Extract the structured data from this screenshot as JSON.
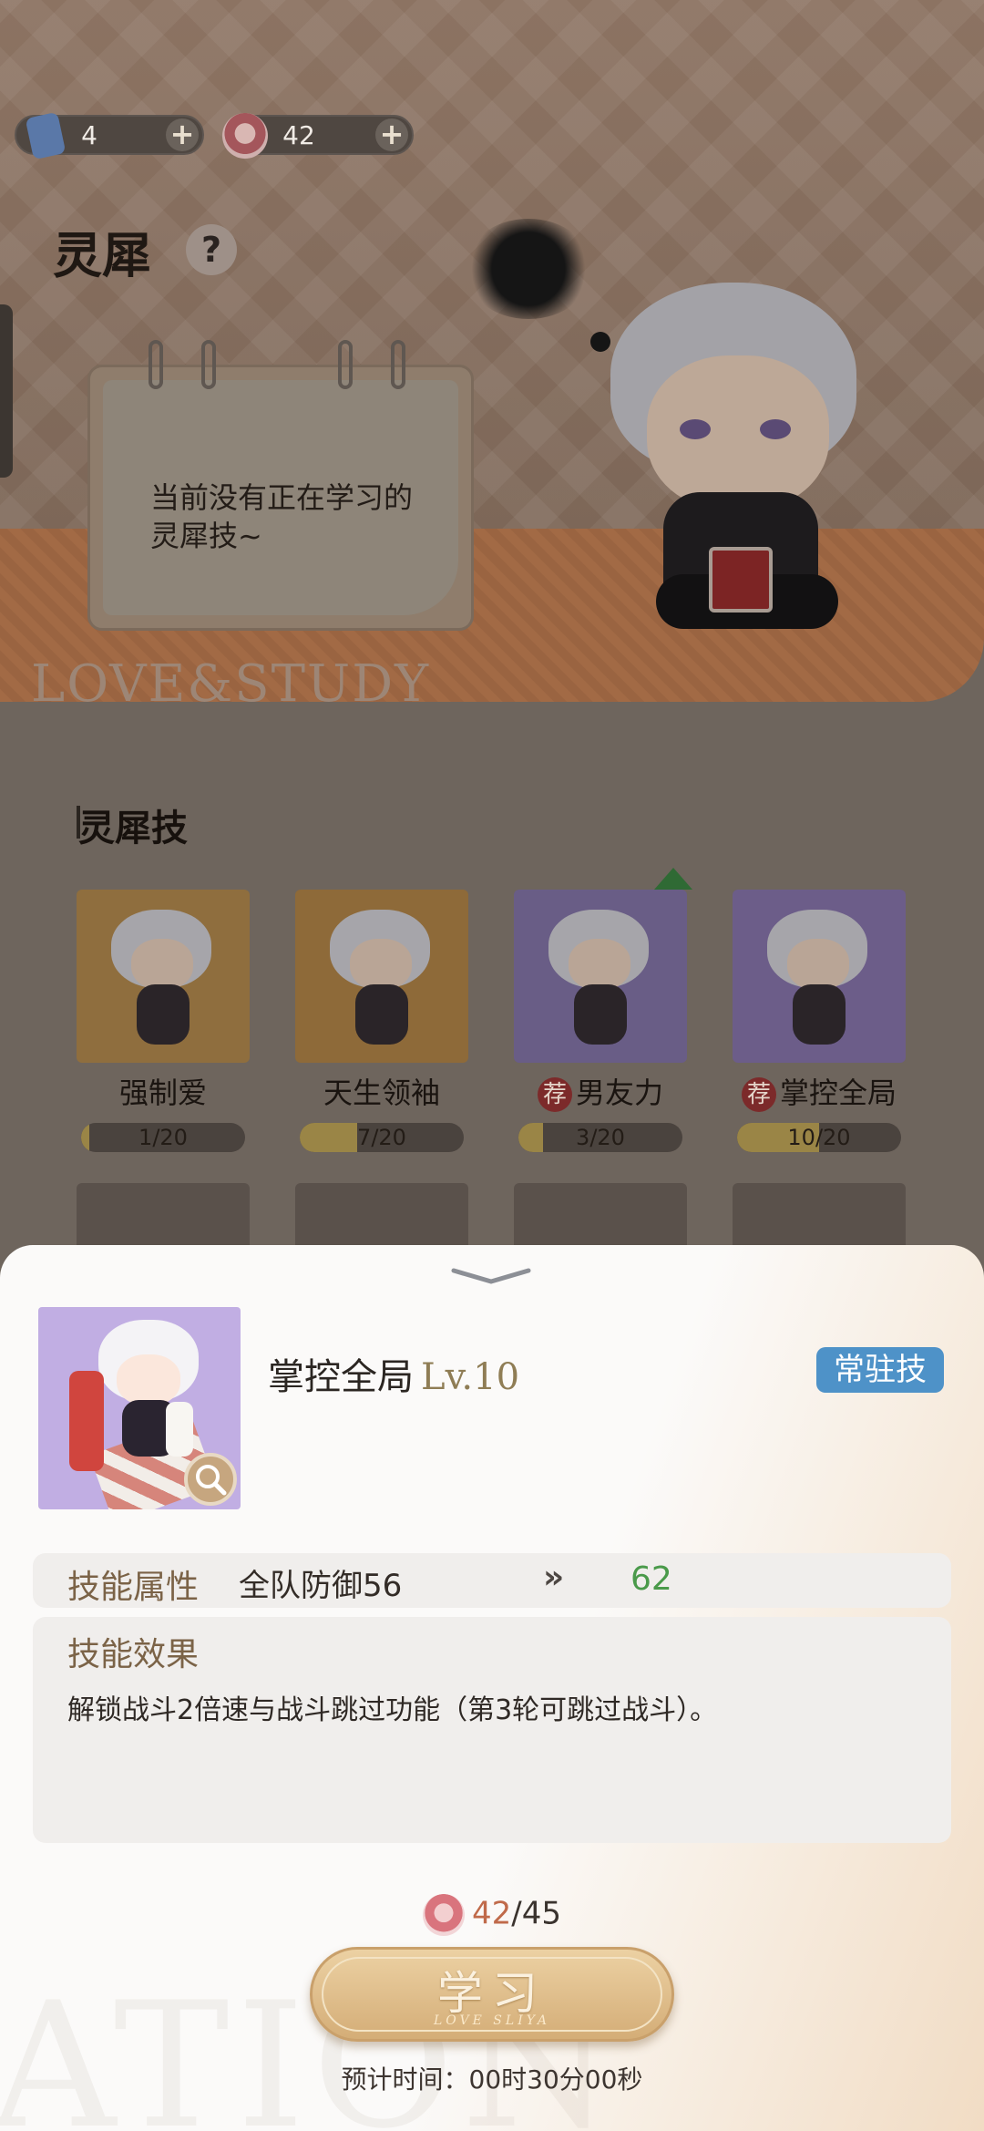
{
  "resources": {
    "tickets": {
      "value": "4",
      "icon": "ticket-icon"
    },
    "tokens": {
      "value": "42",
      "icon": "pink-token-icon"
    }
  },
  "header": {
    "title": "灵犀",
    "help": "?"
  },
  "notebook": {
    "text": "当前没有正在学习的灵犀技~"
  },
  "banner": {
    "watermark": "LOVE&STUDY"
  },
  "skills_section": {
    "title": "灵犀技",
    "recommend_tag": "荐",
    "cards": [
      {
        "name": "强制爱",
        "progress_text": "1/20",
        "progress": 0.05,
        "recommended": false,
        "art_color": "#8f6e3e"
      },
      {
        "name": "天生领袖",
        "progress_text": "7/20",
        "progress": 0.35,
        "recommended": false,
        "art_color": "#8e6a39"
      },
      {
        "name": "男友力",
        "progress_text": "3/20",
        "progress": 0.15,
        "recommended": true,
        "art_color": "#695d86"
      },
      {
        "name": "掌控全局",
        "progress_text": "10/20",
        "progress": 0.5,
        "recommended": true,
        "art_color": "#6c5d89"
      }
    ]
  },
  "detail": {
    "skill_name": "掌控全局",
    "skill_level": "Lv.10",
    "badge": "常驻技",
    "attribute_label": "技能属性",
    "attribute_value": "全队防御56",
    "attribute_arrow": "»",
    "attribute_new": "62",
    "effect_label": "技能效果",
    "effect_text": "解锁战斗2倍速与战斗跳过功能（第3轮可跳过战斗）。",
    "cost_have": "42",
    "cost_need": "/45",
    "learn_label": "学习",
    "learn_sub": "LOVE SLIYA",
    "eta": "预计时间：00时30分00秒",
    "watermark": "ATION"
  },
  "colors": {
    "badge_blue": "#4e92c8",
    "attr_green": "#4a9a4a",
    "accent_gold": "#d4ad77"
  }
}
